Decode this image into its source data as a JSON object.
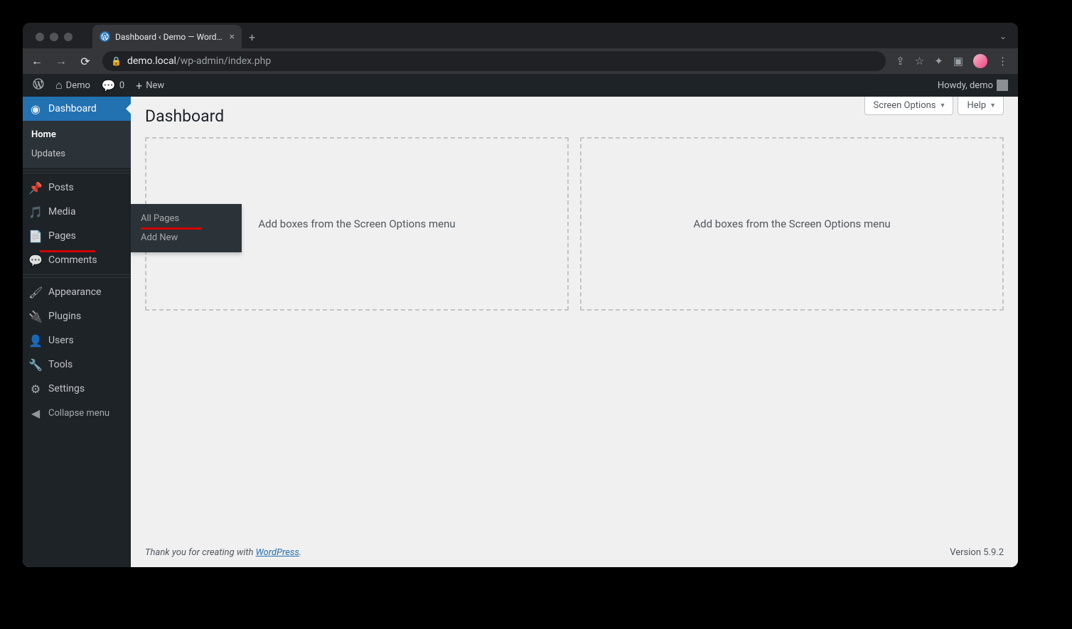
{
  "browser": {
    "tab_title": "Dashboard ‹ Demo — WordPre",
    "url_host": "demo.local",
    "url_path": "/wp-admin/index.php"
  },
  "adminbar": {
    "site": "Demo",
    "comments": "0",
    "new": "New",
    "howdy": "Howdy, demo"
  },
  "sidebar": {
    "dashboard": "Dashboard",
    "sub_dashboard": {
      "home": "Home",
      "updates": "Updates"
    },
    "posts": "Posts",
    "media": "Media",
    "pages": "Pages",
    "comments": "Comments",
    "appearance": "Appearance",
    "plugins": "Plugins",
    "users": "Users",
    "tools": "Tools",
    "settings": "Settings",
    "collapse": "Collapse menu"
  },
  "flyout_pages": {
    "all": "All Pages",
    "add": "Add New"
  },
  "screen": {
    "options": "Screen Options",
    "help": "Help"
  },
  "heading": "Dashboard",
  "widget_placeholder": "Add boxes from the Screen Options menu",
  "footer": {
    "thanks_pre": "Thank you for creating with ",
    "thanks_link": "WordPress",
    "version": "Version 5.9.2"
  }
}
